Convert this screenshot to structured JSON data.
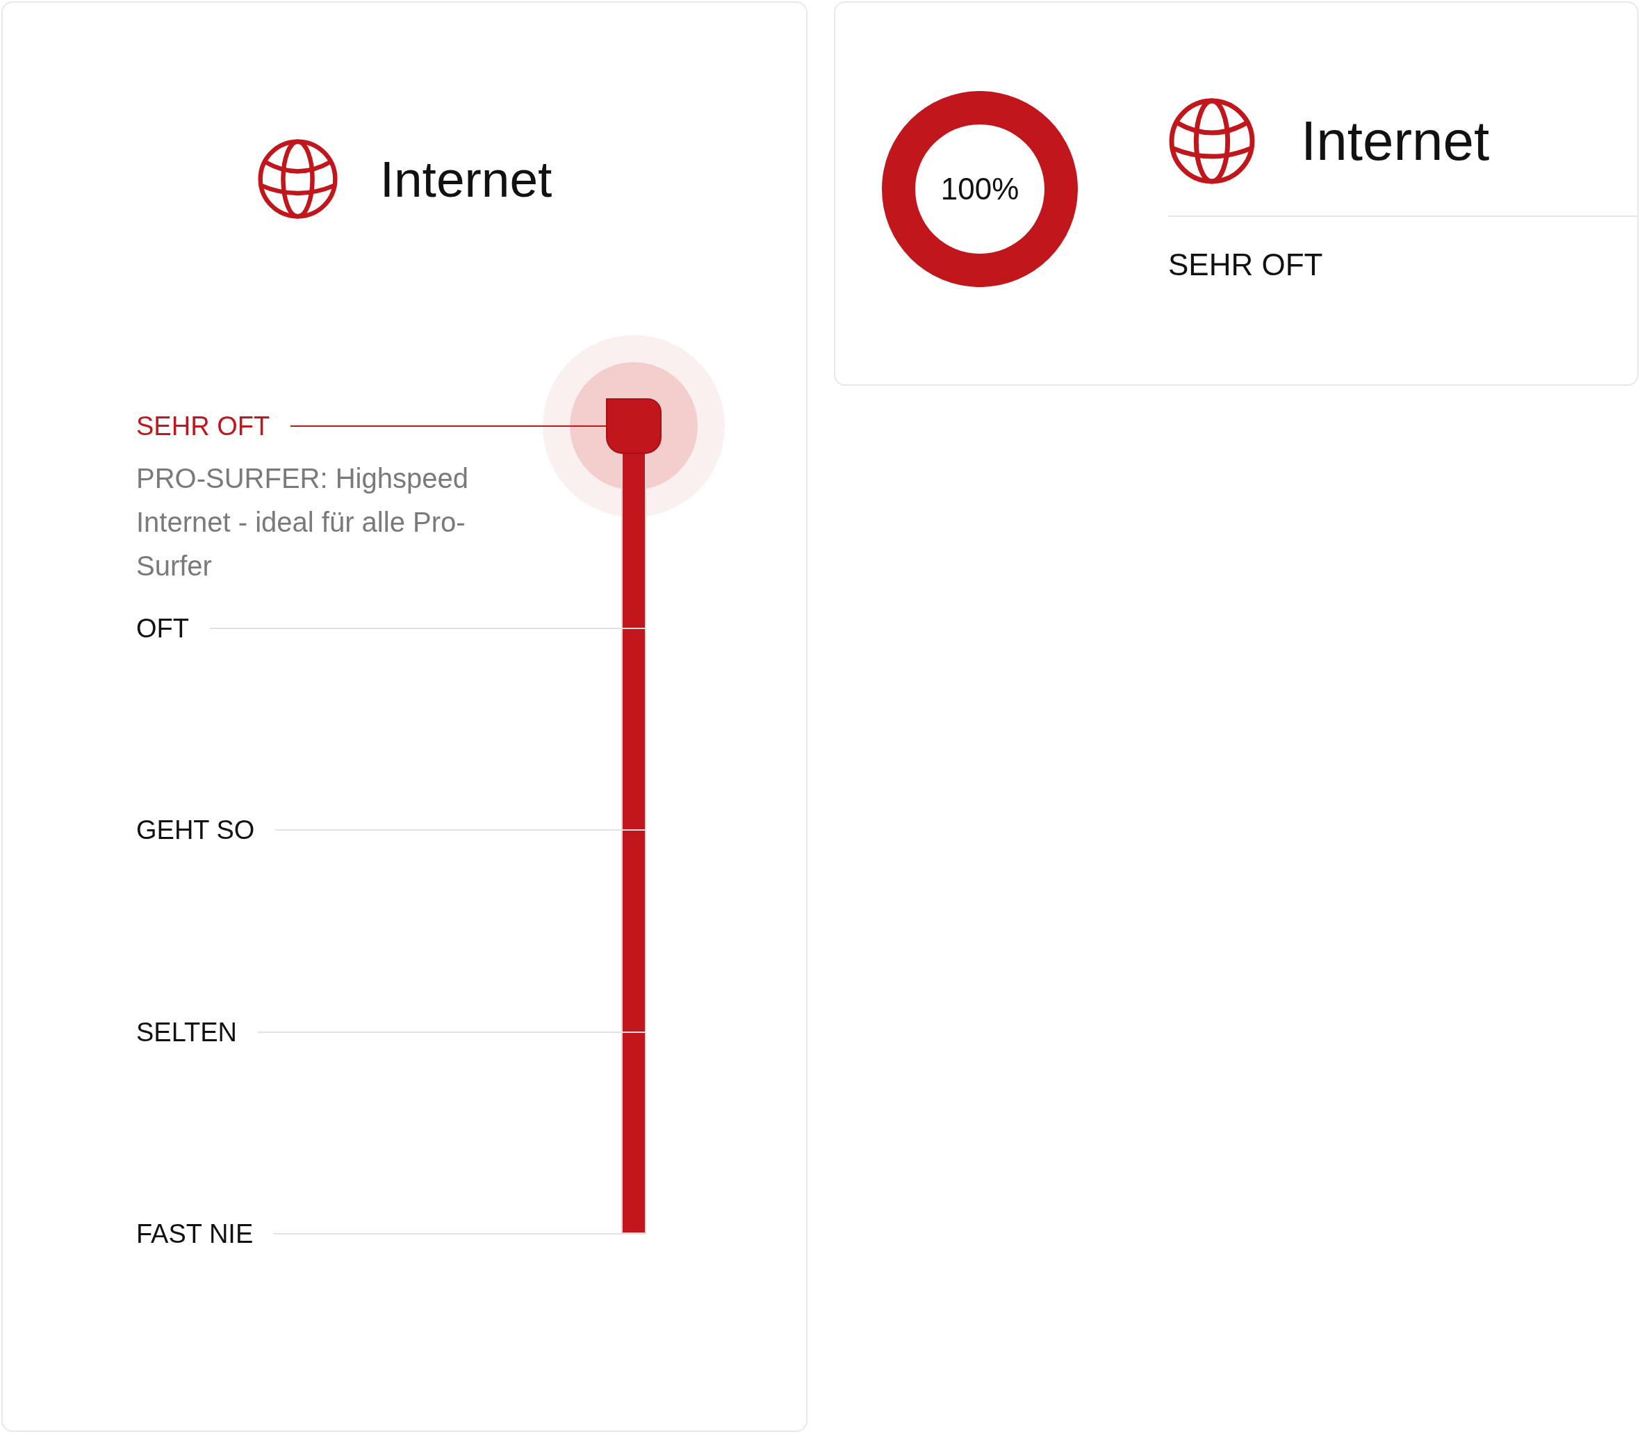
{
  "left_card": {
    "title": "Internet",
    "slider": {
      "level": 1,
      "stops": [
        {
          "label": "SEHR OFT",
          "selected": true,
          "description": "PRO-SURFER: Highspeed Internet - ideal für alle Pro-Surfer"
        },
        {
          "label": "OFT",
          "selected": false
        },
        {
          "label": "GEHT SO",
          "selected": false
        },
        {
          "label": "SELTEN",
          "selected": false
        },
        {
          "label": "FAST NIE",
          "selected": false
        }
      ]
    }
  },
  "right_card": {
    "gauge": {
      "level": 1,
      "reading": "100%"
    },
    "title": "Internet",
    "value": "SEHR OFT"
  }
}
